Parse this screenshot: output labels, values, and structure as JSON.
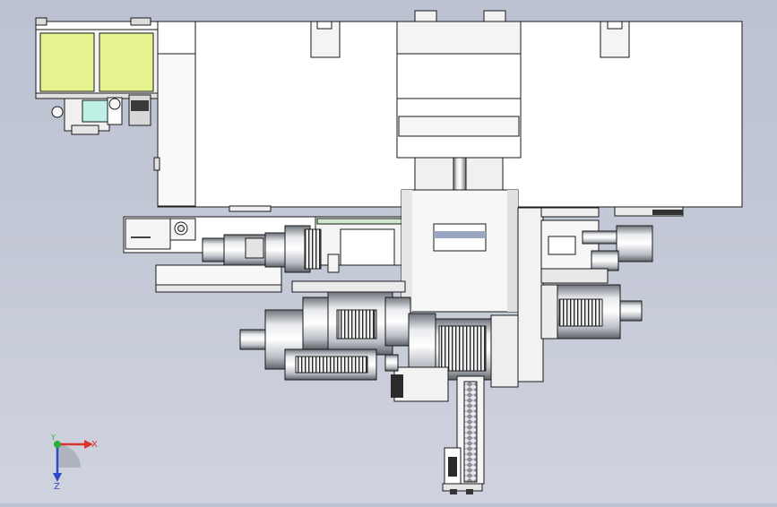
{
  "triad": {
    "x_label": "X",
    "y_label": "Y",
    "z_label": "Z"
  },
  "colors": {
    "background": "#c4c9d7",
    "panel_fill": "#e6f28e",
    "teal_part": "#bff0e6",
    "body_fill": "#ffffff",
    "x_axis": "#d9342b",
    "y_axis": "#2fae3a",
    "z_axis": "#3048c8"
  },
  "icons": [
    "triad-icon",
    "motor-icon",
    "gearbox-icon",
    "rack-icon"
  ]
}
